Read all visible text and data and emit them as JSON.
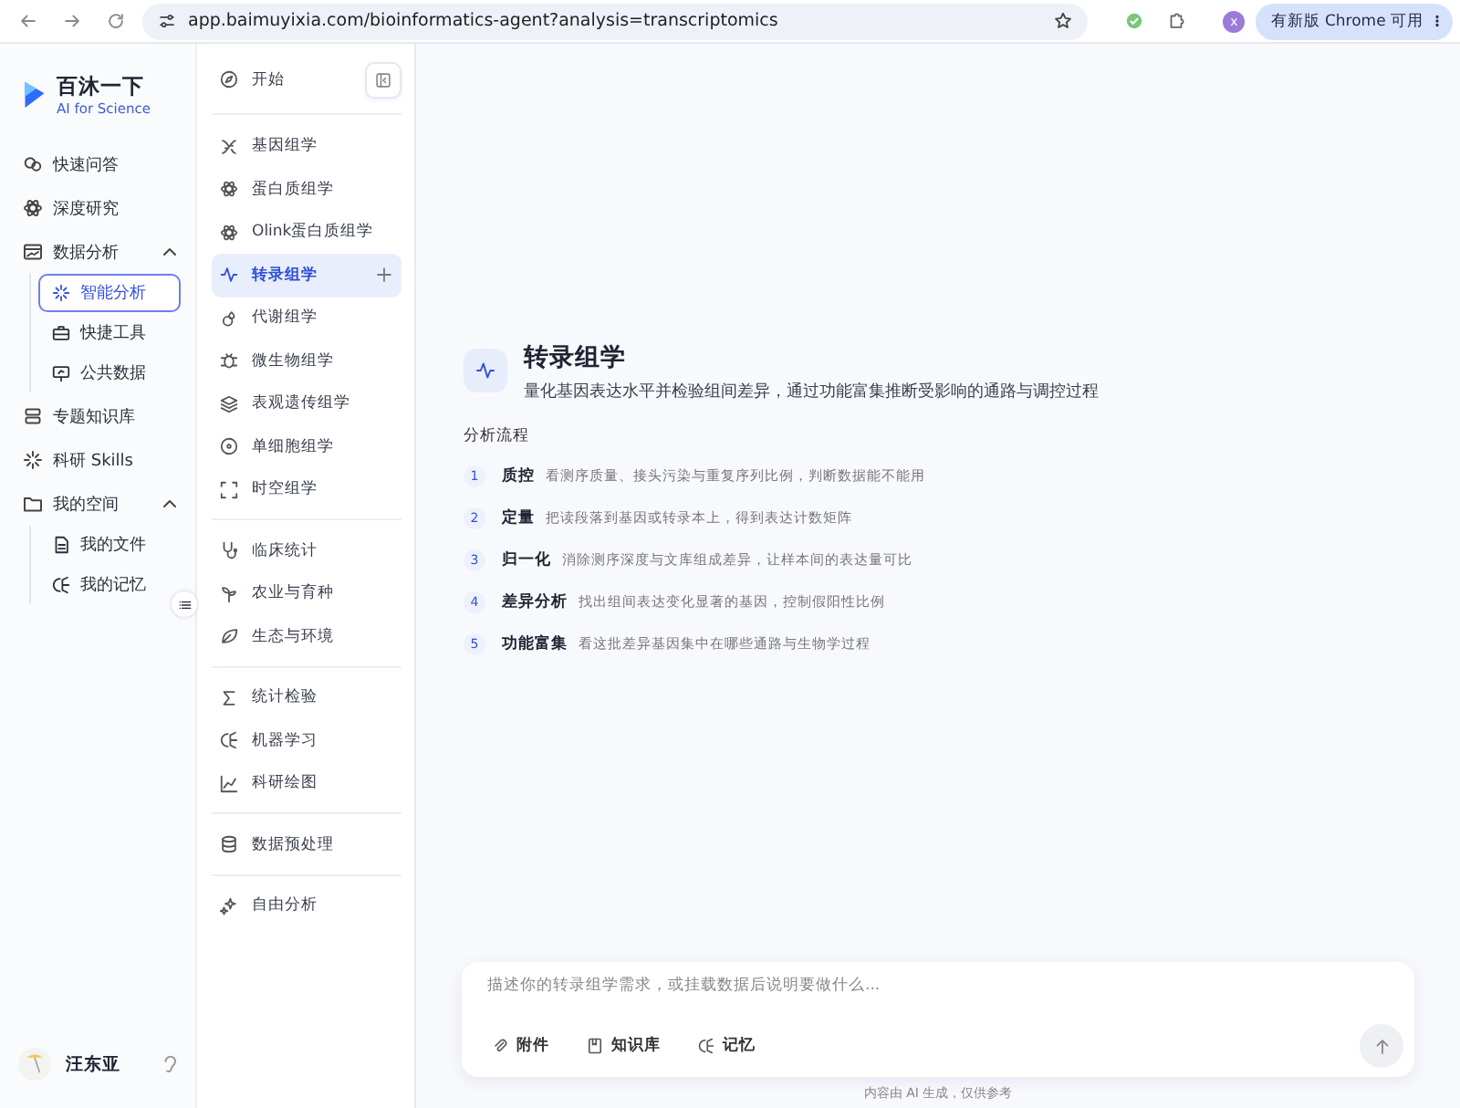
{
  "browser": {
    "url": "app.baimuyixia.com/bioinformatics-agent?analysis=transcriptomics",
    "profile": "x",
    "update_button": "有新版 Chrome 可用"
  },
  "sidebar": {
    "brand": {
      "name": "百沐一下",
      "tagline": "AI for Science"
    },
    "items": [
      {
        "label": "快速问答",
        "selected": false
      },
      {
        "label": "深度研究",
        "selected": false
      },
      {
        "label": "数据分析",
        "selected": false,
        "expanded": true,
        "children": [
          {
            "label": "智能分析",
            "selected": true
          },
          {
            "label": "快捷工具",
            "selected": false
          },
          {
            "label": "公共数据",
            "selected": false
          }
        ]
      },
      {
        "label": "专题知识库",
        "selected": false
      },
      {
        "label": "科研 Skills",
        "selected": false
      },
      {
        "label": "我的空间",
        "selected": false,
        "expanded": true,
        "children": [
          {
            "label": "我的文件",
            "selected": false
          },
          {
            "label": "我的记忆",
            "selected": false
          }
        ]
      }
    ],
    "user": {
      "name": "汪东亚"
    }
  },
  "analysis_nav": {
    "start": {
      "label": "开始"
    },
    "groups": [
      [
        {
          "label": "基因组学",
          "selected": false
        },
        {
          "label": "蛋白质组学",
          "selected": false
        },
        {
          "label": "Olink蛋白质组学",
          "selected": false
        },
        {
          "label": "转录组学",
          "selected": true
        },
        {
          "label": "代谢组学",
          "selected": false
        },
        {
          "label": "微生物组学",
          "selected": false
        },
        {
          "label": "表观遗传组学",
          "selected": false
        },
        {
          "label": "单细胞组学",
          "selected": false
        },
        {
          "label": "时空组学",
          "selected": false
        }
      ],
      [
        {
          "label": "临床统计",
          "selected": false
        },
        {
          "label": "农业与育种",
          "selected": false
        },
        {
          "label": "生态与环境",
          "selected": false
        }
      ],
      [
        {
          "label": "统计检验",
          "selected": false
        },
        {
          "label": "机器学习",
          "selected": false
        },
        {
          "label": "科研绘图",
          "selected": false
        }
      ],
      [
        {
          "label": "数据预处理",
          "selected": false
        }
      ],
      [
        {
          "label": "自由分析",
          "selected": false
        }
      ]
    ]
  },
  "main": {
    "title": "转录组学",
    "subtitle": "量化基因表达水平并检验组间差异，通过功能富集推断受影响的通路与调控过程",
    "flow_label": "分析流程",
    "steps": [
      {
        "number": "1",
        "title": "质控",
        "description": "看测序质量、接头污染与重复序列比例，判断数据能不能用"
      },
      {
        "number": "2",
        "title": "定量",
        "description": "把读段落到基因或转录本上，得到表达计数矩阵"
      },
      {
        "number": "3",
        "title": "归一化",
        "description": "消除测序深度与文库组成差异，让样本间的表达量可比"
      },
      {
        "number": "4",
        "title": "差异分析",
        "description": "找出组间表达变化显著的基因，控制假阳性比例"
      },
      {
        "number": "5",
        "title": "功能富集",
        "description": "看这批差异基因集中在哪些通路与生物学过程"
      }
    ],
    "composer": {
      "placeholder": "描述你的转录组学需求，或挂载数据后说明要做什么...",
      "tools": [
        "附件",
        "知识库",
        "记忆"
      ]
    },
    "disclaimer": "内容由 AI 生成，仅供参考"
  }
}
